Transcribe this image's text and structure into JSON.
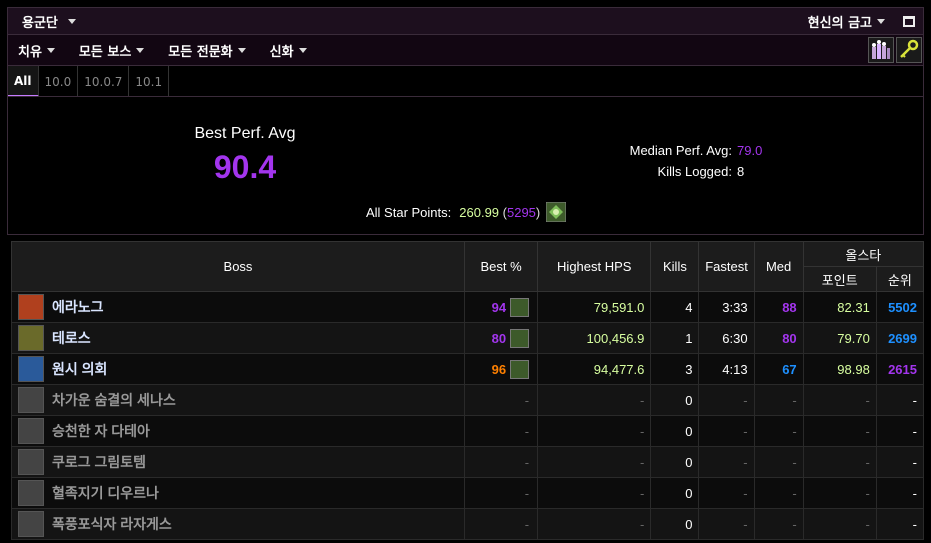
{
  "topbar": {
    "title": "용군단",
    "vault": "현신의 금고"
  },
  "filters": [
    {
      "label": "치유"
    },
    {
      "label": "모든 보스"
    },
    {
      "label": "모든 전문화"
    },
    {
      "label": "신화"
    }
  ],
  "tabs": [
    "All",
    "10.0",
    "10.0.7",
    "10.1"
  ],
  "summary": {
    "best_perf_label": "Best Perf. Avg",
    "best_perf_value": "90.4",
    "median_label": "Median Perf. Avg:",
    "median_value": "79.0",
    "kills_label": "Kills Logged:",
    "kills_value": "8",
    "star_label": "All Star Points:",
    "star_points": "260.99",
    "star_rank": "5295"
  },
  "table": {
    "headers": {
      "boss": "Boss",
      "best": "Best %",
      "hps": "Highest HPS",
      "kills": "Kills",
      "fastest": "Fastest",
      "med": "Med",
      "allstar": "올스타",
      "points": "포인트",
      "rank": "순위"
    },
    "rows": [
      {
        "name": "에라노그",
        "best": "94",
        "hps": "79,591.0",
        "kills": "4",
        "fastest": "3:33",
        "med": "88",
        "points": "82.31",
        "rank": "5502",
        "killed": true,
        "bestColor": "purple",
        "medColor": "purple",
        "rankColor": "blue",
        "icon": "#b0401e"
      },
      {
        "name": "테로스",
        "best": "80",
        "hps": "100,456.9",
        "kills": "1",
        "fastest": "6:30",
        "med": "80",
        "points": "79.70",
        "rank": "2699",
        "killed": true,
        "bestColor": "purple",
        "medColor": "purple",
        "rankColor": "blue",
        "icon": "#6a6a2a"
      },
      {
        "name": "원시 의회",
        "best": "96",
        "hps": "94,477.6",
        "kills": "3",
        "fastest": "4:13",
        "med": "67",
        "points": "98.98",
        "rank": "2615",
        "killed": true,
        "bestColor": "orange",
        "medColor": "blue",
        "rankColor": "purple",
        "icon": "#2a5a9a"
      },
      {
        "name": "차가운 숨결의 세나스",
        "best": "-",
        "hps": "-",
        "kills": "0",
        "fastest": "-",
        "med": "-",
        "points": "-",
        "rank": "-",
        "killed": false,
        "icon": "#444"
      },
      {
        "name": "승천한 자 다테아",
        "best": "-",
        "hps": "-",
        "kills": "0",
        "fastest": "-",
        "med": "-",
        "points": "-",
        "rank": "-",
        "killed": false,
        "icon": "#444"
      },
      {
        "name": "쿠로그 그림토템",
        "best": "-",
        "hps": "-",
        "kills": "0",
        "fastest": "-",
        "med": "-",
        "points": "-",
        "rank": "-",
        "killed": false,
        "icon": "#444"
      },
      {
        "name": "혈족지기 디우르나",
        "best": "-",
        "hps": "-",
        "kills": "0",
        "fastest": "-",
        "med": "-",
        "points": "-",
        "rank": "-",
        "killed": false,
        "icon": "#444"
      },
      {
        "name": "폭풍포식자 라자게스",
        "best": "-",
        "hps": "-",
        "kills": "0",
        "fastest": "-",
        "med": "-",
        "points": "-",
        "rank": "-",
        "killed": false,
        "icon": "#444"
      }
    ]
  }
}
